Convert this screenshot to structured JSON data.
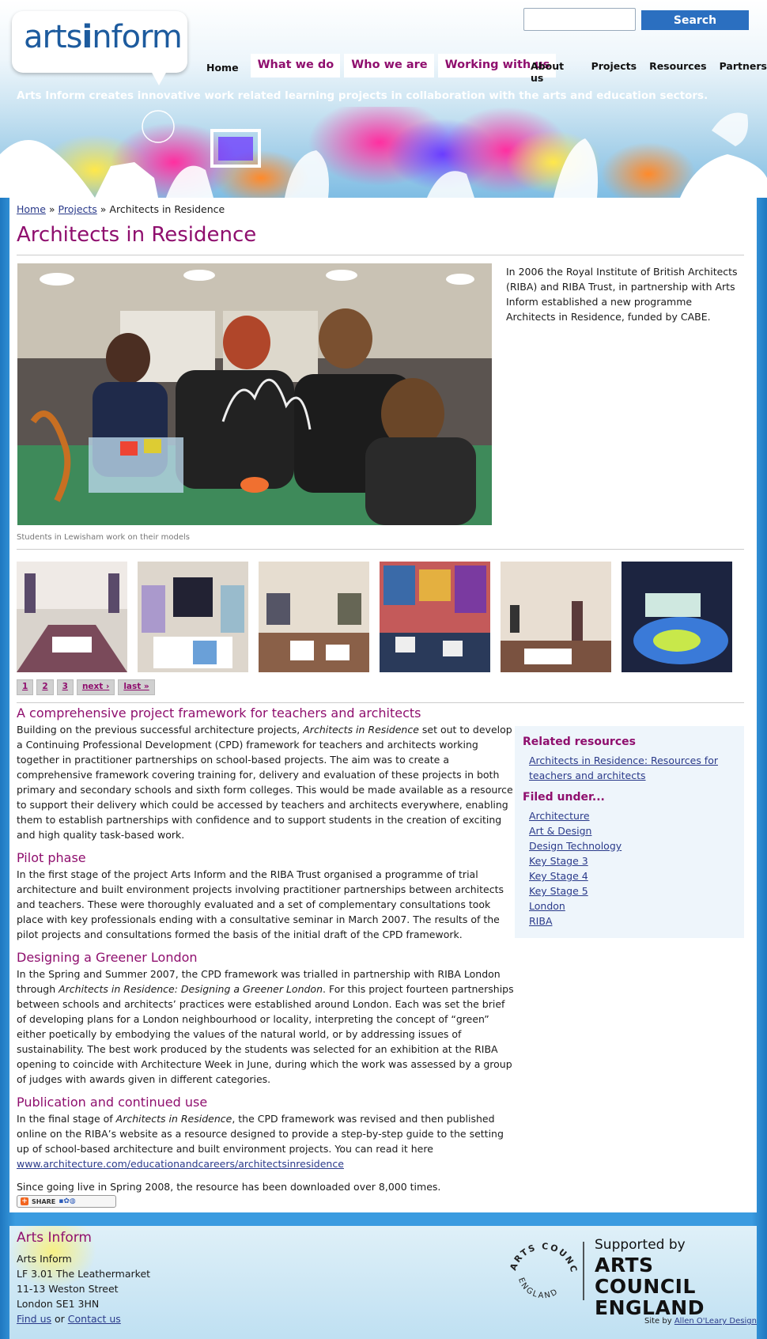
{
  "header": {
    "logo_text": "artsinform",
    "search_placeholder": "",
    "search_button": "Search",
    "nav_home": "Home",
    "nav_tabs": [
      "What we do",
      "Who we are",
      "Working with us"
    ],
    "sub_nav": [
      "About us",
      "Projects",
      "Resources",
      "Partners"
    ],
    "tagline": "Arts Inform creates innovative work related learning projects in collaboration with the arts and education sectors."
  },
  "breadcrumb": {
    "home": "Home",
    "sep": " » ",
    "projects": "Projects",
    "current": "Architects in Residence"
  },
  "page": {
    "title": "Architects in Residence",
    "hero_caption": "Students in Lewisham work on their models",
    "intro": "In 2006 the Royal Institute of British Architects (RIBA) and RIBA Trust, in partnership with Arts Inform established a new programme Architects in Residence, funded by CABE."
  },
  "pager": [
    "1",
    "2",
    "3",
    "next ›",
    "last »"
  ],
  "article": {
    "s1_title": "A comprehensive project framework for teachers and architects",
    "s1_pre": "Building on the previous successful architecture projects, ",
    "s1_em": "Architects in Residence",
    "s1_post": " set out to develop a Continuing Professional Development (CPD) framework for teachers and architects working together in practitioner partnerships on school-based projects. The aim was to create a comprehensive framework covering training for, delivery and evaluation of these projects in both primary and secondary schools and sixth form colleges. This would be made available as a resource to support their delivery which could be accessed by teachers and architects everywhere, enabling them to establish partnerships with confidence and to support students in the creation of exciting and high quality task-based work.",
    "s2_title": "Pilot phase",
    "s2_text": "In the first stage of the project Arts Inform and the RIBA Trust organised a programme of trial architecture and built environment projects involving practitioner partnerships between architects and teachers. These were thoroughly evaluated and a set of complementary consultations took place with key professionals ending with a consultative seminar in March 2007. The results of the pilot projects and consultations formed the basis of the initial draft of the CPD framework.",
    "s3_title": "Designing a Greener London",
    "s3_pre": "In the Spring and Summer 2007, the CPD framework was trialled in partnership with RIBA London through ",
    "s3_em": "Architects in Residence: Designing a Greener London",
    "s3_post": ". For this project fourteen partnerships between schools and architects’ practices were established around London. Each was set the brief of developing plans for a London neighbourhood or locality, interpreting the concept of “green” either poetically by embodying the values of the natural world, or by addressing issues of sustainability. The best work produced by the students was selected for an exhibition at the RIBA opening to coincide with Architecture Week in June, during which the work was assessed by a group of judges with awards given in different categories.",
    "s4_title": "Publication and continued use",
    "s4_pre": "In the final stage of ",
    "s4_em": "Architects in Residence",
    "s4_post": ", the CPD framework was revised and then published online on the RIBA’s website as a resource designed to provide a step-by-step guide to the setting up of school-based architecture and built environment projects. You can read it here",
    "s4_link": "www.architecture.com/educationandcareers/architectsinresidence",
    "s5_text": "Since going live in Spring 2008, the resource has been downloaded over 8,000 times.",
    "share_label": "SHARE"
  },
  "sidebar": {
    "related_title": "Related resources",
    "related_link": "Architects in Residence: Resources for teachers and architects",
    "filed_title": "Filed under...",
    "filed_items": [
      "Architecture",
      "Art & Design",
      "Design Technology",
      "Key Stage 3",
      "Key Stage 4",
      "Key Stage 5",
      "London",
      "RIBA"
    ]
  },
  "footer": {
    "title": "Arts Inform",
    "address": [
      "Arts Inform",
      "LF 3.01 The Leathermarket",
      "11-13 Weston Street",
      "London SE1 3HN"
    ],
    "find_us": "Find us",
    "or": " or ",
    "contact_us": "Contact us",
    "supported_by": "Supported by",
    "ace_line1": "ARTS COUNCIL",
    "ace_line2": "ENGLAND",
    "site_by_prefix": "Site by ",
    "site_by_link": "Allen O'Leary Design"
  },
  "colors": {
    "brand_magenta": "#8f0f6e",
    "brand_blue": "#1d5b9e",
    "search_button": "#2b6fc0",
    "page_background": "#3a9be0"
  }
}
